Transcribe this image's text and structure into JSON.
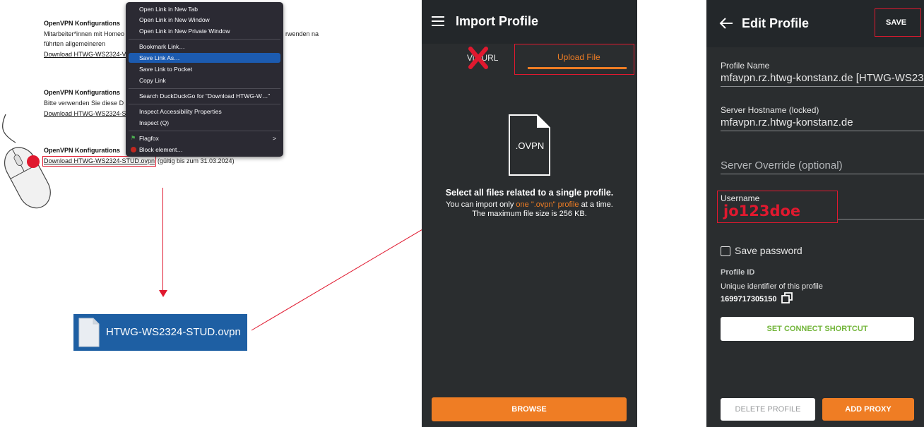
{
  "webpage": {
    "sections": [
      {
        "heading": "OpenVPN Konfigurations",
        "text_lines": [
          "Mitarbeiter*innen mit Homeo",
          "führten allgemeineren"
        ],
        "right_text": "rwenden na",
        "link": "Download HTWG-WS2324-V"
      },
      {
        "heading": "OpenVPN Konfigurations",
        "text_lines": [
          "Bitte verwenden Sie diese D"
        ],
        "link": "Download HTWG-WS2324-S"
      },
      {
        "heading": "OpenVPN Konfigurations",
        "link": "Download HTWG-WS2324-STUD.ovpn",
        "after_link": "(gültig bis zum 31.03.2024)"
      }
    ]
  },
  "context_menu": {
    "items": [
      {
        "label": "Open Link in New Tab"
      },
      {
        "label": "Open Link in New Window"
      },
      {
        "label": "Open Link in New Private Window"
      },
      {
        "label": "Bookmark Link…"
      },
      {
        "label": "Save Link As…",
        "selected": true
      },
      {
        "label": "Save Link to Pocket"
      },
      {
        "label": "Copy Link"
      },
      {
        "label": "Search DuckDuckGo for “Download HTWG-W…”"
      },
      {
        "label": "Inspect Accessibility Properties"
      },
      {
        "label": "Inspect (Q)"
      },
      {
        "label": "Flagfox",
        "submenu_arrow": ">"
      },
      {
        "label": "Block element…"
      }
    ]
  },
  "downloaded_file": {
    "name": "HTWG-WS2324-STUD.ovpn",
    "icon": "file-icon"
  },
  "import_profile": {
    "title": "Import Profile",
    "tabs": [
      {
        "label": "Via URL"
      },
      {
        "label": "Upload File",
        "active": true
      }
    ],
    "file_icon_text": ".OVPN",
    "headline": "Select all files related to a single profile.",
    "desc_before": "You can import only",
    "desc_highlight": "one \".ovpn\" profile",
    "desc_after": "at a time.",
    "desc_line2": "The maximum file size is 256 KB.",
    "browse_label": "BROWSE"
  },
  "edit_profile": {
    "title": "Edit Profile",
    "save_label": "SAVE",
    "profile_name_label": "Profile Name",
    "profile_name_value": "mfavpn.rz.htwg-konstanz.de [HTWG-WS23",
    "server_hostname_label": "Server Hostname (locked)",
    "server_hostname_value": "mfavpn.rz.htwg-konstanz.de",
    "server_override_placeholder": "Server Override (optional)",
    "username_label": "Username",
    "username_value": "jo123doe",
    "save_password_label": "Save password",
    "profile_id_heading": "Profile ID",
    "profile_id_desc": "Unique identifier of this profile",
    "profile_id_value": "1699717305150",
    "connect_shortcut_label": "SET CONNECT SHORTCUT",
    "delete_label": "DELETE PROFILE",
    "add_proxy_label": "ADD PROXY"
  },
  "colors": {
    "accent": "#ef7d24",
    "annotation": "#e0192f",
    "menu_highlight": "#1c5bb0",
    "file_bar": "#1e5fa3",
    "app_bg": "#2a2d2f",
    "link_green": "#74b63c"
  }
}
